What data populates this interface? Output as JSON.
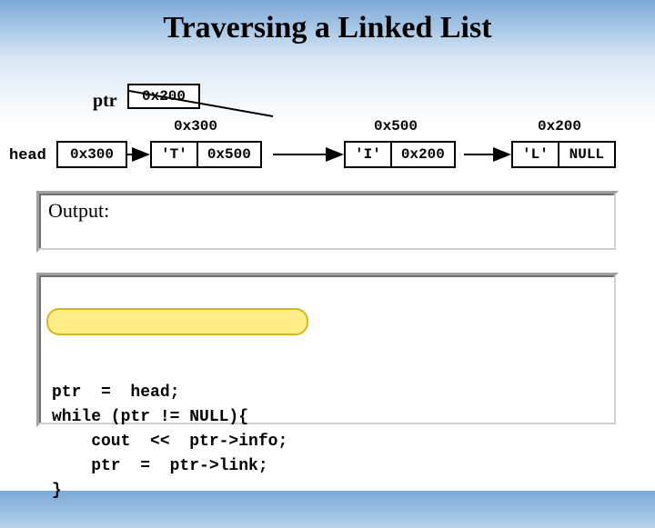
{
  "title": "Traversing a Linked List",
  "ptr": {
    "label": "ptr",
    "value": "0x200"
  },
  "head": {
    "label": "head",
    "value": "0x300"
  },
  "addresses": {
    "n1": "0x300",
    "n2": "0x500",
    "n3": "0x200"
  },
  "nodes": {
    "n1": {
      "info": "'T'",
      "link": "0x500"
    },
    "n2": {
      "info": "'I'",
      "link": "0x200"
    },
    "n3": {
      "info": "'L'",
      "link": "NULL"
    }
  },
  "output": {
    "label": "Output:"
  },
  "code": {
    "line1": "ptr  =  head;",
    "line2": "while (ptr != NULL){",
    "line3": "    cout  <<  ptr->info;",
    "line4": "    ptr  =  ptr->link;",
    "line5": "}"
  }
}
